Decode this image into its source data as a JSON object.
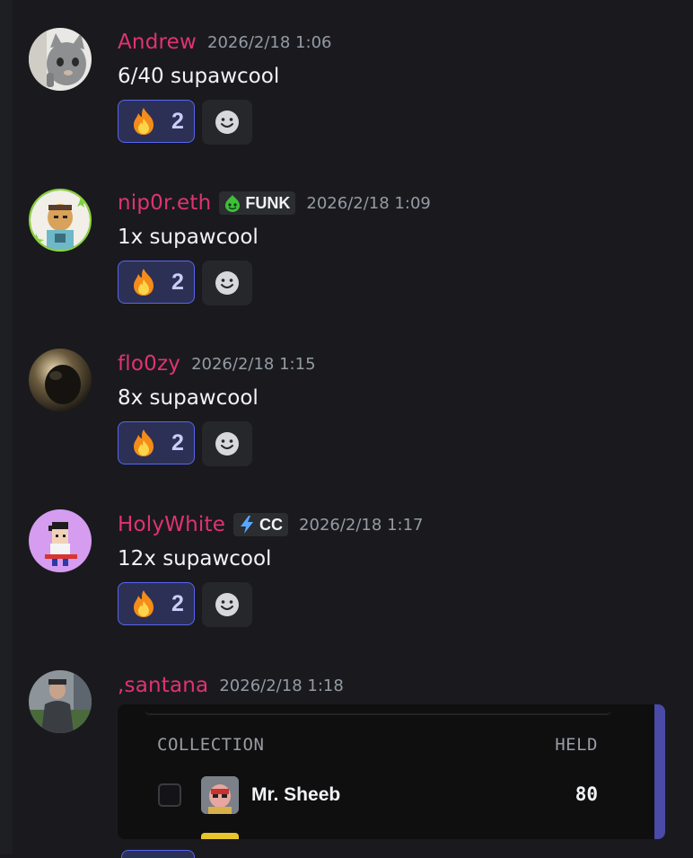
{
  "messages": [
    {
      "username": "Andrew",
      "tag": null,
      "timestamp": "2026/2/18 1:06",
      "content": "6/40 supawcool",
      "reaction": {
        "emoji": "fire-icon",
        "count": "2"
      }
    },
    {
      "username": "nip0r.eth",
      "tag": {
        "icon": "green-slime-icon",
        "label": "FUNK"
      },
      "timestamp": "2026/2/18 1:09",
      "content": "1x supawcool",
      "reaction": {
        "emoji": "fire-icon",
        "count": "2"
      }
    },
    {
      "username": "flo0zy",
      "tag": null,
      "timestamp": "2026/2/18 1:15",
      "content": "8x supawcool",
      "reaction": {
        "emoji": "fire-icon",
        "count": "2"
      }
    },
    {
      "username": "HolyWhite",
      "tag": {
        "icon": "lightning-icon",
        "label": "CC"
      },
      "timestamp": "2026/2/18 1:17",
      "content": "12x supawcool",
      "reaction": {
        "emoji": "fire-icon",
        "count": "2"
      }
    },
    {
      "username": ",santana",
      "tag": null,
      "timestamp": "2026/2/18 1:18",
      "content": "",
      "reaction": null
    }
  ],
  "embed": {
    "columns": {
      "collection": "COLLECTION",
      "held": "HELD"
    },
    "rows": [
      {
        "name": "Mr. Sheeb",
        "held": "80"
      }
    ],
    "accent_color": "#4a4aa8"
  },
  "colors": {
    "username": "#e0336f",
    "reaction_bg": "#2c3054",
    "reaction_border": "#5865f2",
    "background": "#1a1a1e"
  }
}
